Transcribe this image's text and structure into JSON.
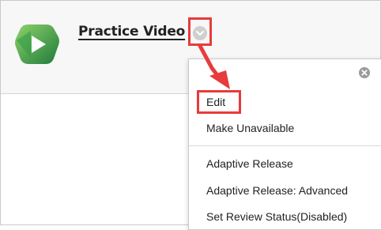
{
  "content_item": {
    "title": "Practice Video",
    "logo_icon": "panopto-play-icon",
    "menu_toggle_icon": "chevron-down-icon"
  },
  "context_menu": {
    "close_icon": "close-circle-icon",
    "items": [
      {
        "label": "Edit",
        "highlighted": true
      },
      {
        "label": "Make Unavailable"
      },
      {
        "label": "Adaptive Release"
      },
      {
        "label": "Adaptive Release: Advanced"
      },
      {
        "label": "Set Review Status(Disabled)"
      }
    ]
  },
  "colors": {
    "highlight": "#e83b3b",
    "logo_dark": "#1f7a3a",
    "logo_light": "#5cbf4c"
  }
}
